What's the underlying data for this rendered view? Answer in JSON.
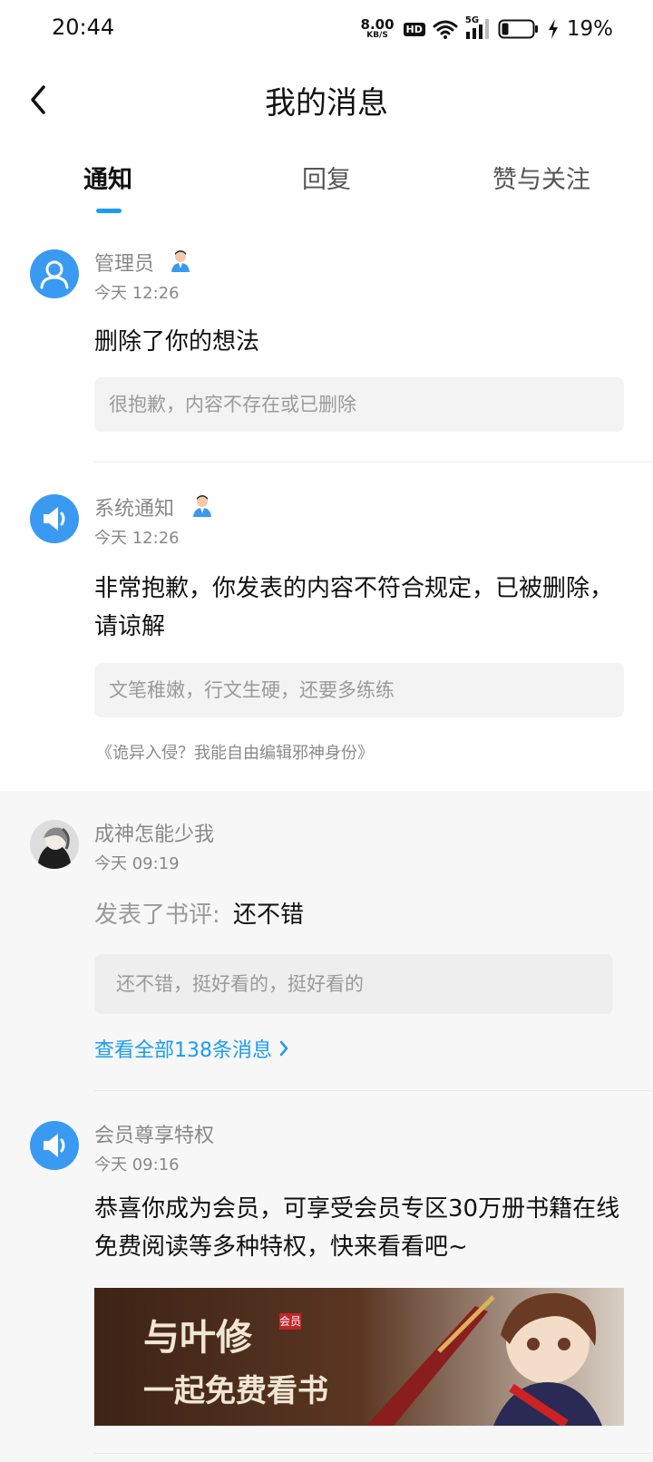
{
  "status_bar": {
    "time": "20:44",
    "net_speed": "8.00",
    "net_unit": "KB/S",
    "hd": "HD",
    "network": "5G",
    "battery": "19%"
  },
  "header": {
    "title": "我的消息"
  },
  "tabs": [
    {
      "label": "通知",
      "active": true
    },
    {
      "label": "回复",
      "active": false
    },
    {
      "label": "赞与关注",
      "active": false
    }
  ],
  "messages": [
    {
      "sender": "管理员",
      "time": "今天 12:26",
      "content": "删除了你的想法",
      "quote": "很抱歉，内容不存在或已删除"
    },
    {
      "sender": "系统通知",
      "time": "今天 12:26",
      "content": "非常抱歉，你发表的内容不符合规定，已被删除，请谅解",
      "quote": "文笔稚嫩，行文生硬，还要多练练",
      "book": "《诡异入侵？我能自由编辑邪神身份》"
    },
    {
      "sender": "成神怎能少我",
      "time": "今天 09:19",
      "content_prefix": "发表了书评:",
      "content_main": "还不错",
      "quote": "还不错，挺好看的，挺好看的",
      "see_all": "查看全部138条消息"
    },
    {
      "sender": "会员尊享特权",
      "time": "今天 09:16",
      "content": "恭喜你成为会员，可享受会员专区30万册书籍在线免费阅读等多种特权，快来看看吧~",
      "banner_line1": "与叶修",
      "banner_badge": "会员",
      "banner_line2": "一起免费看书"
    }
  ],
  "colors": {
    "accent": "#1a9cf0",
    "avatar_blue": "#3a9af2"
  }
}
